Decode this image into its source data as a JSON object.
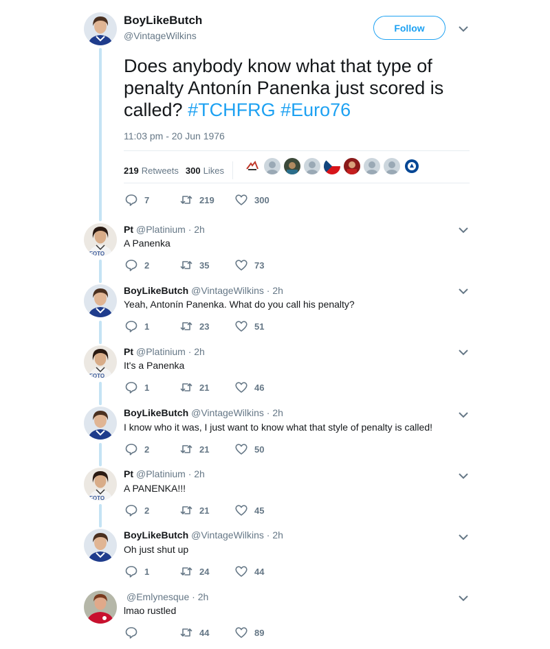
{
  "main_tweet": {
    "display_name": "BoyLikeButch",
    "handle": "@VintageWilkins",
    "follow_label": "Follow",
    "text_plain": "Does anybody know what that type of penalty Antonín Panenka just scored is called?",
    "hashtags": [
      "#TCHFRG",
      "#Euro76"
    ],
    "timestamp": "11:03 pm - 20 Jun 1976",
    "retweets_count": "219",
    "retweets_label": "Retweets",
    "likes_count": "300",
    "likes_label": "Likes",
    "liker_avatars": [
      "logo-avatar",
      "default-avatar",
      "photo-avatar",
      "default-avatar",
      "czech-flag-avatar",
      "red-photo-avatar",
      "default-avatar",
      "default-avatar",
      "chelsea-crest-avatar"
    ],
    "actions": {
      "replies": "7",
      "retweets": "219",
      "likes": "300"
    }
  },
  "replies": [
    {
      "name": "Pt",
      "handle": "@Platinium",
      "time": "· 2h",
      "text": "A Panenka",
      "replies": "2",
      "retweets": "35",
      "likes": "73",
      "avatar": "pt"
    },
    {
      "name": "BoyLikeButch",
      "handle": "@VintageWilkins",
      "time": "· 2h",
      "text": "Yeah, Antonín Panenka. What do you call his penalty?",
      "replies": "1",
      "retweets": "23",
      "likes": "51",
      "avatar": "blb"
    },
    {
      "name": "Pt",
      "handle": "@Platinium",
      "time": "· 2h",
      "text": "It's a Panenka",
      "replies": "1",
      "retweets": "21",
      "likes": "46",
      "avatar": "pt"
    },
    {
      "name": "BoyLikeButch",
      "handle": "@VintageWilkins",
      "time": "· 2h",
      "text": "I know who it was, I just want to know what that style of penalty is called!",
      "replies": "2",
      "retweets": "21",
      "likes": "50",
      "avatar": "blb"
    },
    {
      "name": "Pt",
      "handle": "@Platinium",
      "time": "· 2h",
      "text": "A PANENKA!!!",
      "replies": "2",
      "retweets": "21",
      "likes": "45",
      "avatar": "pt"
    },
    {
      "name": "BoyLikeButch",
      "handle": "@VintageWilkins",
      "time": "· 2h",
      "text": "Oh just shut up",
      "replies": "1",
      "retweets": "24",
      "likes": "44",
      "avatar": "blb"
    },
    {
      "name": "",
      "handle": "@Emlynesque",
      "time": "· 2h",
      "text": "lmao rustled",
      "replies": "",
      "retweets": "44",
      "likes": "89",
      "avatar": "em"
    }
  ],
  "colors": {
    "accent": "#1da1f2",
    "thread_line": "#c4e3f4",
    "secondary_text": "#657786",
    "primary_text": "#14171a"
  }
}
